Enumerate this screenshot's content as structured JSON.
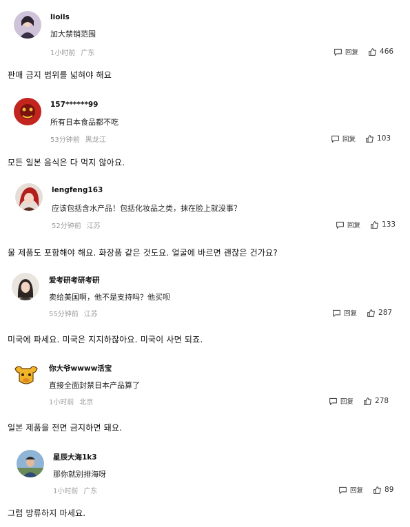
{
  "comments": [
    {
      "username": "lioils",
      "content": "加大禁销范围",
      "time": "1小时前",
      "location": "广东",
      "reply_label": "回复",
      "likes": "466",
      "translation": "판매 금지 범위를 넓혀야 해요",
      "avatar": "woman-portrait-avatar"
    },
    {
      "username": "157******99",
      "content": "所有日本食品都不吃",
      "time": "53分钟前",
      "location": "黑龙江",
      "reply_label": "回复",
      "likes": "103",
      "translation": "모든 일본 음식은 다 먹지 않아요.",
      "avatar": "red-mask-avatar"
    },
    {
      "username": "lengfeng163",
      "content": "应该包括含水产品！包括化妆品之类，抹在脸上就没事？",
      "time": "52分钟前",
      "location": "江苏",
      "reply_label": "回复",
      "likes": "133",
      "translation": "물 제품도 포함해야 해요. 화장품 같은 것도요. 얼굴에 바르면 괜찮은 건가요?",
      "avatar": "red-hair-character-avatar"
    },
    {
      "username": "爱考研考研考研",
      "content": "卖给美国啊，他不是支持吗？他买呗",
      "time": "55分钟前",
      "location": "江苏",
      "reply_label": "回复",
      "likes": "287",
      "translation": "미국에 파세요. 미국은 지지하잖아요. 미국이 사면 되죠.",
      "avatar": "girl-photo-avatar"
    },
    {
      "username": "你大爷wwww活宝",
      "content": "直接全面封禁日本产品算了",
      "time": "1小时前",
      "location": "北京",
      "reply_label": "回复",
      "likes": "278",
      "translation": "일본 제품을 전면 금지하면 돼요.",
      "avatar": "yellow-bull-avatar"
    },
    {
      "username": "星辰大海1k3",
      "content": "那你就别排海呀",
      "time": "1小时前",
      "location": "广东",
      "reply_label": "回复",
      "likes": "89",
      "translation": "그럼 방류하지 마세요.",
      "avatar": "man-photo-avatar"
    }
  ],
  "colors": {
    "meta": "#9a9a9a",
    "text": "#222222"
  }
}
